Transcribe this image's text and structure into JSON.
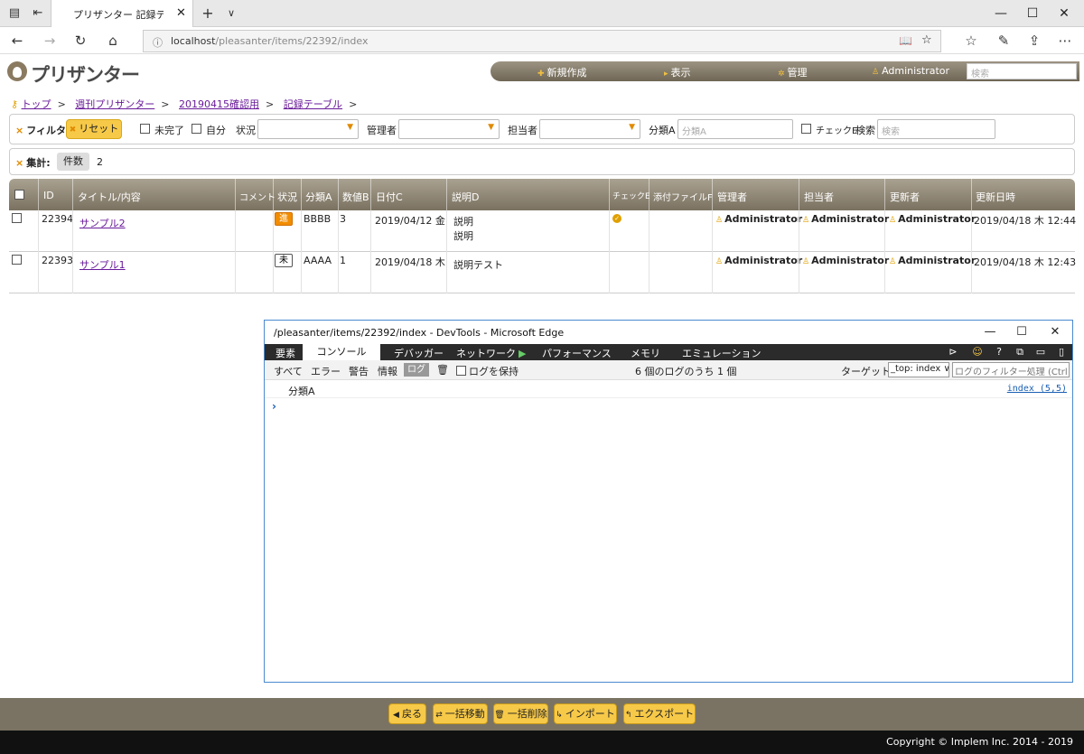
{
  "browser": {
    "tab_title": "プリザンター 記録テーブル ‹",
    "url_host": "localhost",
    "url_path": "/pleasanter/items/22392/index",
    "new_tab": "+",
    "tab_dropdown": "∨"
  },
  "app": {
    "logo": "プリザンター",
    "menu": {
      "new": "新規作成",
      "view": "表示",
      "manage": "管理",
      "user": "Administrator"
    },
    "search_placeholder": "検索"
  },
  "breadcrumb": [
    "トップ",
    "週刊プリザンター",
    "20190415確認用",
    "記録テーブル"
  ],
  "filter": {
    "label": "フィルタ:",
    "reset": "リセット",
    "incomplete": "未完了",
    "self": "自分",
    "status": "状況",
    "manager": "管理者",
    "owner": "担当者",
    "class_a": "分類A",
    "class_a_placeholder": "分類A",
    "check_e": "チェックE",
    "search": "検索",
    "search_placeholder": "検索"
  },
  "aggregate": {
    "label": "集計:",
    "count_label": "件数",
    "count": "2"
  },
  "grid": {
    "headers": [
      "ID",
      "タイトル/内容",
      "コメント",
      "状況",
      "分類A",
      "数値B",
      "日付C",
      "説明D",
      "チェックE",
      "添付ファイルF",
      "管理者",
      "担当者",
      "更新者",
      "更新日時"
    ],
    "rows": [
      {
        "id": "22394",
        "title": "サンプル2",
        "status": "進",
        "class_a": "BBBB",
        "num_b": "3",
        "date_c": "2019/04/12 金",
        "desc_d_1": "説明",
        "desc_d_2": "説明",
        "manager": "Administrator",
        "owner": "Administrator",
        "updater": "Administrator",
        "updated": "2019/04/18 木 12:44"
      },
      {
        "id": "22393",
        "title": "サンプル1",
        "status": "未",
        "class_a": "AAAA",
        "num_b": "1",
        "date_c": "2019/04/18 木",
        "desc_d_1": "説明テスト",
        "desc_d_2": "",
        "manager": "Administrator",
        "owner": "Administrator",
        "updater": "Administrator",
        "updated": "2019/04/18 木 12:43"
      }
    ]
  },
  "devtools": {
    "title": "/pleasanter/items/22392/index - DevTools - Microsoft Edge",
    "tabs": [
      "要素",
      "コンソール",
      "デバッガー",
      "ネットワーク",
      "パフォーマンス",
      "メモリ",
      "エミュレーション"
    ],
    "tools": {
      "all": "すべて",
      "error": "エラー",
      "warning": "警告",
      "info": "情報",
      "log": "ログ",
      "keep_log": "ログを保持",
      "summary": "6 個のログのうち 1 個",
      "target": "ターゲット",
      "target_value": "_top: index",
      "filter_placeholder": "ログのフィルター処理 (Ctrl +"
    },
    "log_text": "分類A",
    "log_source": "index (5,5)",
    "prompt": "›"
  },
  "bottom": {
    "back": "戻る",
    "bulk_move": "一括移動",
    "bulk_delete": "一括削除",
    "import": "インポート",
    "export": "エクスポート"
  },
  "copyright": "Copyright © Implem Inc. 2014 - 2019"
}
